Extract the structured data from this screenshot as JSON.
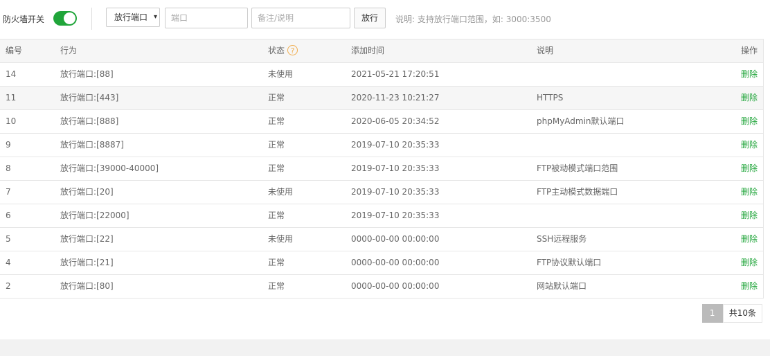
{
  "toolbar": {
    "firewall_label": "防火墙开关",
    "firewall_on": true,
    "action_select": "放行端口",
    "port_placeholder": "端口",
    "note_placeholder": "备注/说明",
    "allow_button": "放行",
    "hint": "说明: 支持放行端口范围，如: 3000:3500"
  },
  "table": {
    "columns": [
      "编号",
      "行为",
      "状态",
      "添加时间",
      "说明",
      "操作"
    ],
    "help_glyph": "?",
    "rows": [
      {
        "id": "14",
        "action": "放行端口:[88]",
        "status": "未使用",
        "time": "2021-05-21 17:20:51",
        "desc": "",
        "op": "删除"
      },
      {
        "id": "11",
        "action": "放行端口:[443]",
        "status": "正常",
        "time": "2020-11-23 10:21:27",
        "desc": "HTTPS",
        "op": "删除"
      },
      {
        "id": "10",
        "action": "放行端口:[888]",
        "status": "正常",
        "time": "2020-06-05 20:34:52",
        "desc": "phpMyAdmin默认端口",
        "op": "删除"
      },
      {
        "id": "9",
        "action": "放行端口:[8887]",
        "status": "正常",
        "time": "2019-07-10 20:35:33",
        "desc": "",
        "op": "删除"
      },
      {
        "id": "8",
        "action": "放行端口:[39000-40000]",
        "status": "正常",
        "time": "2019-07-10 20:35:33",
        "desc": "FTP被动模式端口范围",
        "op": "删除"
      },
      {
        "id": "7",
        "action": "放行端口:[20]",
        "status": "未使用",
        "time": "2019-07-10 20:35:33",
        "desc": "FTP主动模式数据端口",
        "op": "删除"
      },
      {
        "id": "6",
        "action": "放行端口:[22000]",
        "status": "正常",
        "time": "2019-07-10 20:35:33",
        "desc": "",
        "op": "删除"
      },
      {
        "id": "5",
        "action": "放行端口:[22]",
        "status": "未使用",
        "time": "0000-00-00 00:00:00",
        "desc": "SSH远程服务",
        "op": "删除"
      },
      {
        "id": "4",
        "action": "放行端口:[21]",
        "status": "正常",
        "time": "0000-00-00 00:00:00",
        "desc": "FTP协议默认端口",
        "op": "删除"
      },
      {
        "id": "2",
        "action": "放行端口:[80]",
        "status": "正常",
        "time": "0000-00-00 00:00:00",
        "desc": "网站默认端口",
        "op": "删除"
      }
    ]
  },
  "pager": {
    "current": "1",
    "total": "共10条"
  }
}
